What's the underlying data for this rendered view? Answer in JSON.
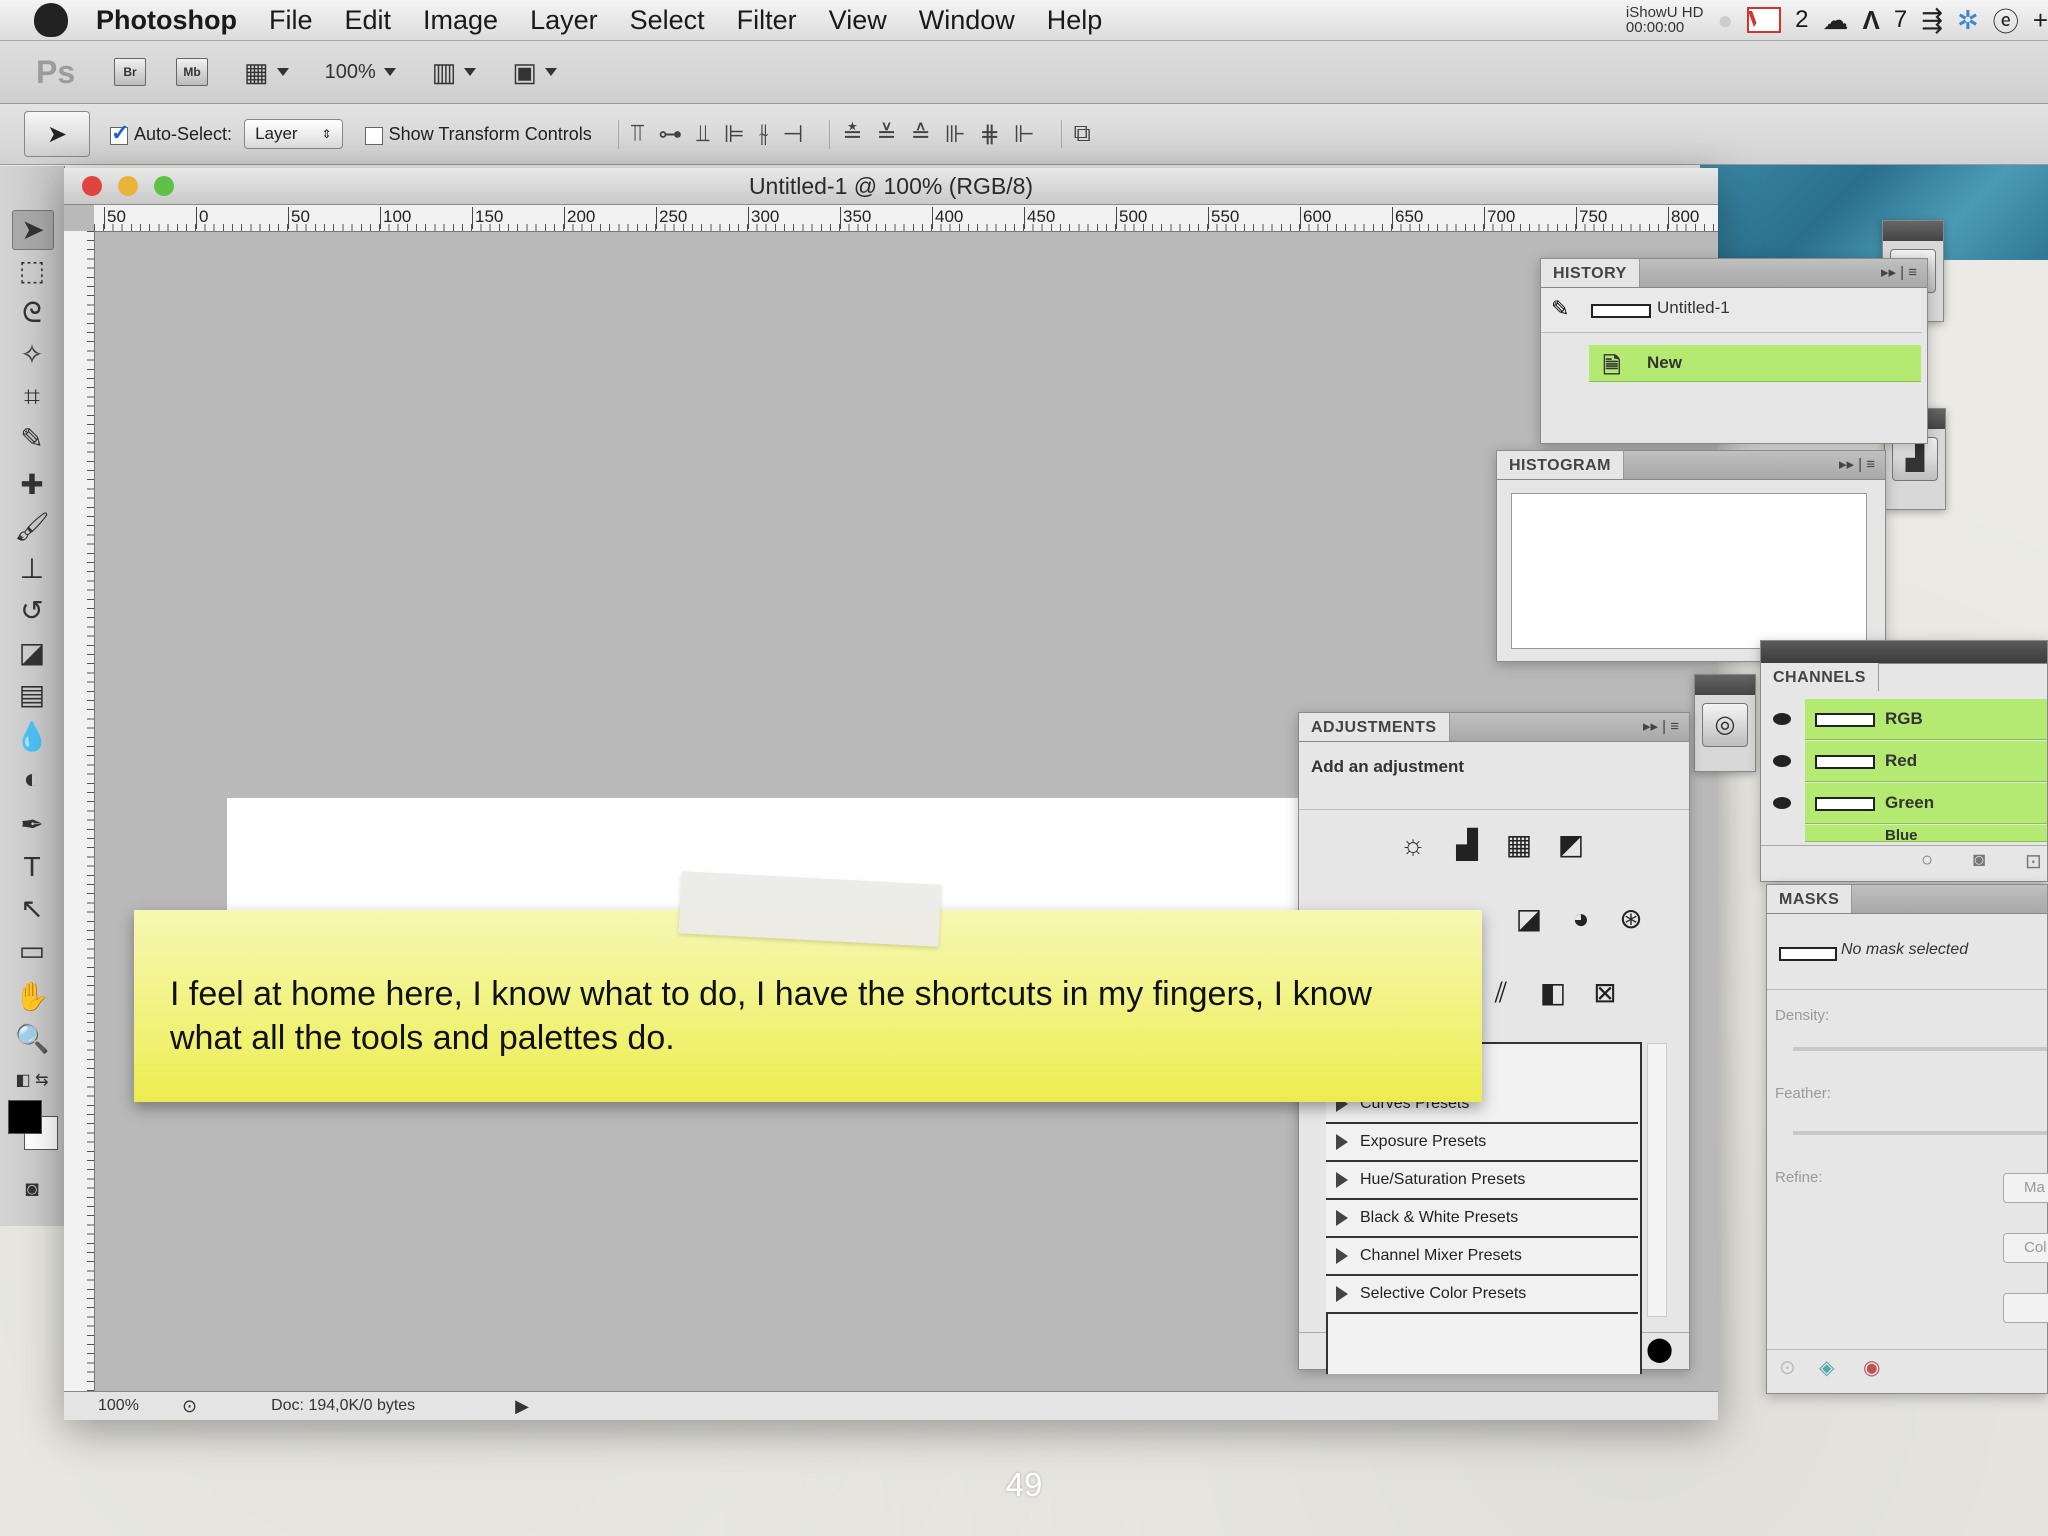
{
  "menubar": {
    "app": "Photoshop",
    "items": [
      "File",
      "Edit",
      "Image",
      "Layer",
      "Select",
      "Filter",
      "View",
      "Window",
      "Help"
    ],
    "ishow_title": "iShowU HD",
    "ishow_time": "00:00:00",
    "gmail_count": "2",
    "adobe_count": "7"
  },
  "appbar": {
    "logo": "Ps",
    "bridge": "Br",
    "minibridge": "Mb",
    "zoom": "100%"
  },
  "options": {
    "auto_select_label": "Auto-Select:",
    "auto_select_checked": true,
    "auto_select_target": "Layer",
    "show_transform_label": "Show Transform Controls",
    "show_transform_checked": false
  },
  "document": {
    "title": "Untitled-1 @ 100% (RGB/8)",
    "ruler_ticks": [
      "50",
      "0",
      "50",
      "100",
      "150",
      "200",
      "250",
      "300",
      "350",
      "400",
      "450",
      "500",
      "550",
      "600",
      "650",
      "700",
      "750",
      "800"
    ],
    "zoom_status": "100%",
    "doc_status": "Doc: 194,0K/0 bytes"
  },
  "history": {
    "tab": "HISTORY",
    "snapshot": "Untitled-1",
    "state": "New"
  },
  "histogram": {
    "tab": "HISTOGRAM"
  },
  "adjustments": {
    "tab": "ADJUSTMENTS",
    "subtitle": "Add an adjustment",
    "presets": [
      "Curves Presets",
      "Exposure Presets",
      "Hue/Saturation Presets",
      "Black & White Presets",
      "Channel Mixer Presets",
      "Selective Color Presets"
    ]
  },
  "channels": {
    "tab": "CHANNELS",
    "items": [
      "RGB",
      "Red",
      "Green",
      "Blue"
    ]
  },
  "masks": {
    "tab": "MASKS",
    "status": "No mask selected",
    "density_label": "Density:",
    "feather_label": "Feather:",
    "refine_label": "Refine:",
    "btn_mask": "Ma",
    "btn_color": "Col"
  },
  "note": {
    "text": "I feel at home here, I know what to do, I have the shortcuts in my fingers, I know what all the tools and palettes do."
  },
  "slide": {
    "page": "49"
  },
  "colors": {
    "history_selected": "#b4ea72",
    "note_yellow": "#eff065",
    "close_light": "#e0443e",
    "min_light": "#e9b43a",
    "zoom_light": "#5ec045"
  }
}
